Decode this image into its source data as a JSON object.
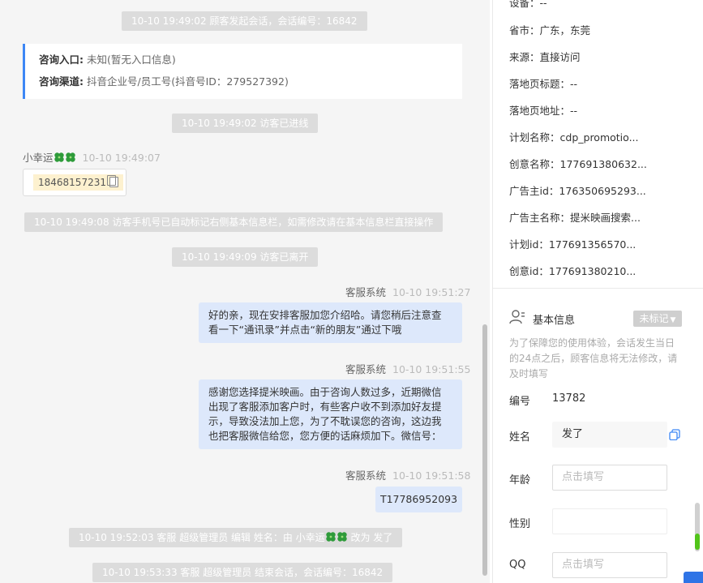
{
  "chat": {
    "session_start": "10-10 19:49:02 顾客发起会话，会话编号：16842",
    "entry_card": {
      "entry_label": "咨询入口:",
      "entry_value": "未知(暂无入口信息)",
      "channel_label": "咨询渠道:",
      "channel_value": "抖音企业号/员工号(抖音号ID：279527392)"
    },
    "visitor_enter": "10-10 19:49:02 访客已进线",
    "visitor_name": "小幸运",
    "visitor_time": "10-10 19:49:07",
    "visitor_phone": "18468157231",
    "auto_tag_notice": "10-10 19:49:08 访客手机号已自动标记右侧基本信息栏，如需修改请在基本信息栏直接操作",
    "visitor_leave": "10-10 19:49:09 访客已离开",
    "messages": [
      {
        "sender": "客服系统",
        "time": "10-10 19:51:27",
        "lines": [
          "好的亲，现在安排客服加您介绍哈。请您稍后注意查",
          "看一下“通讯录”并点击“新的朋友”通过下哦"
        ]
      },
      {
        "sender": "客服系统",
        "time": "10-10 19:51:55",
        "lines": [
          "感谢您选择提米映画。由于咨询人数过多，近期微信",
          "出现了客服添加客户时，有些客户收不到添加好友提",
          "示，导致没法加上您，为了不耽误您的咨询，这边我",
          "也把客服微信给您，您方便的话麻烦加下。微信号："
        ]
      },
      {
        "sender": "客服系统",
        "time": "10-10 19:51:58",
        "lines": [
          "T17786952093"
        ]
      }
    ],
    "rename_prefix": "10-10 19:52:03 客服 超级管理员 编辑 姓名：由 小幸运",
    "rename_suffix": "改为 发了",
    "session_end": "10-10 19:53:33 客服 超级管理员 结束会话，会话编号：16842"
  },
  "panel": {
    "info": [
      {
        "label": "设备：",
        "value": "--"
      },
      {
        "label": "省市：",
        "value": "广东，东莞"
      },
      {
        "label": "来源：",
        "value": "直接访问"
      },
      {
        "label": "落地页标题：",
        "value": "--"
      },
      {
        "label": "落地页地址：",
        "value": "--"
      },
      {
        "label": "计划名称：",
        "value": "cdp_promotio..."
      },
      {
        "label": "创意名称：",
        "value": "177691380632..."
      },
      {
        "label": "广告主id：",
        "value": "176350695293..."
      },
      {
        "label": "广告主名称：",
        "value": "提米映画搜索..."
      },
      {
        "label": "计划id：",
        "value": "177691356570..."
      },
      {
        "label": "创意id：",
        "value": "177691380210..."
      }
    ],
    "basic_info_title": "基本信息",
    "untagged": "未标记",
    "notice": "为了保障您的使用体验，会话发生当日的24点之后，顾客信息将无法修改，请及时填写",
    "number_label": "编号",
    "number_value": "13782",
    "name_label": "姓名",
    "name_value": "发了",
    "age_label": "年龄",
    "age_placeholder": "点击填写",
    "gender_label": "性别",
    "gender_value": "",
    "qq_label": "QQ",
    "qq_placeholder": "点击填写"
  },
  "colors": {
    "accent": "#3d87f5",
    "agent_bubble": "#dde8fb",
    "system_pill": "#dcdcdc",
    "phone_chip": "#fdf1cf",
    "scroll_green": "#52c41a"
  }
}
